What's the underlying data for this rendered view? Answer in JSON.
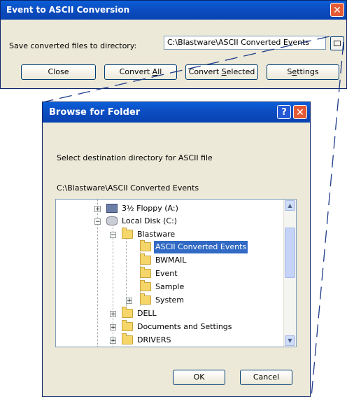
{
  "main_dialog": {
    "title": "Event to ASCII Conversion",
    "close_glyph": "✕",
    "save_label": "Save converted files to directory:",
    "directory_value": "C:\\Blastware\\ASCII Converted Events",
    "browse_icon": "browse-folder-icon",
    "buttons": {
      "close": "Close",
      "convert_all_a": "Convert ",
      "convert_all_u": "A",
      "convert_all_b": "ll",
      "convert_selected_a": "Convert ",
      "convert_selected_u": "S",
      "convert_selected_b": "elected",
      "settings_a": "S",
      "settings_u": "e",
      "settings_b": "ttings"
    }
  },
  "browse_dialog": {
    "title": "Browse for Folder",
    "help_glyph": "?",
    "close_glyph": "✕",
    "instruction": "Select destination directory for ASCII file",
    "current_path": "C:\\Blastware\\ASCII Converted Events",
    "tree": [
      {
        "label": "3½ Floppy (A:)",
        "icon": "floppy-drive-icon"
      },
      {
        "label": "Local Disk (C:)",
        "icon": "hard-disk-icon"
      },
      {
        "label": "Blastware",
        "icon": "folder-open-icon"
      },
      {
        "label": "ASCII Converted Events",
        "icon": "folder-open-icon",
        "selected": true
      },
      {
        "label": "BWMAIL",
        "icon": "folder-icon"
      },
      {
        "label": "Event",
        "icon": "folder-icon"
      },
      {
        "label": "Sample",
        "icon": "folder-icon"
      },
      {
        "label": "System",
        "icon": "folder-icon"
      },
      {
        "label": "DELL",
        "icon": "folder-icon"
      },
      {
        "label": "Documents and Settings",
        "icon": "folder-icon"
      },
      {
        "label": "DRIVERS",
        "icon": "folder-icon"
      }
    ],
    "ok_label": "OK",
    "cancel_label": "Cancel"
  },
  "colors": {
    "title_bar": "#0c4fc4",
    "dialog_bg": "#ece9d8",
    "selection": "#316ac5",
    "close_button": "#e35a34"
  }
}
